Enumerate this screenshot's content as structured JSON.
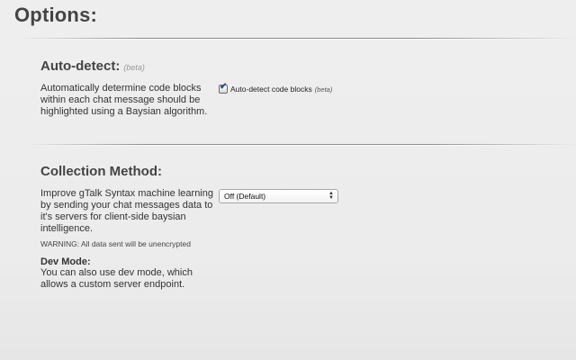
{
  "page": {
    "title": "Options"
  },
  "auto_detect": {
    "title": "Auto-detect:",
    "beta_tag": "(beta)",
    "description": "Automatically determine code blocks within each chat message should be highlighted using a Baysian algorithm.",
    "checkbox_label": "Auto-detect code blocks",
    "checkbox_beta_tag": "(beta)",
    "checked": true
  },
  "collection_method": {
    "title": "Collection Method:",
    "description": "Improve gTalk Syntax machine learning by sending your chat messages data to it's servers for client-side baysian intelligence.",
    "warning": "WARNING: All data sent will be unencrypted",
    "select_value": "Off (Default)",
    "dev_mode": {
      "title": "Dev Mode:",
      "description": "You can also use dev mode, which allows a custom server endpoint."
    }
  },
  "icons": {
    "checkbox_check": "checkmark-icon",
    "select_arrows": "up-down-arrows-icon"
  }
}
